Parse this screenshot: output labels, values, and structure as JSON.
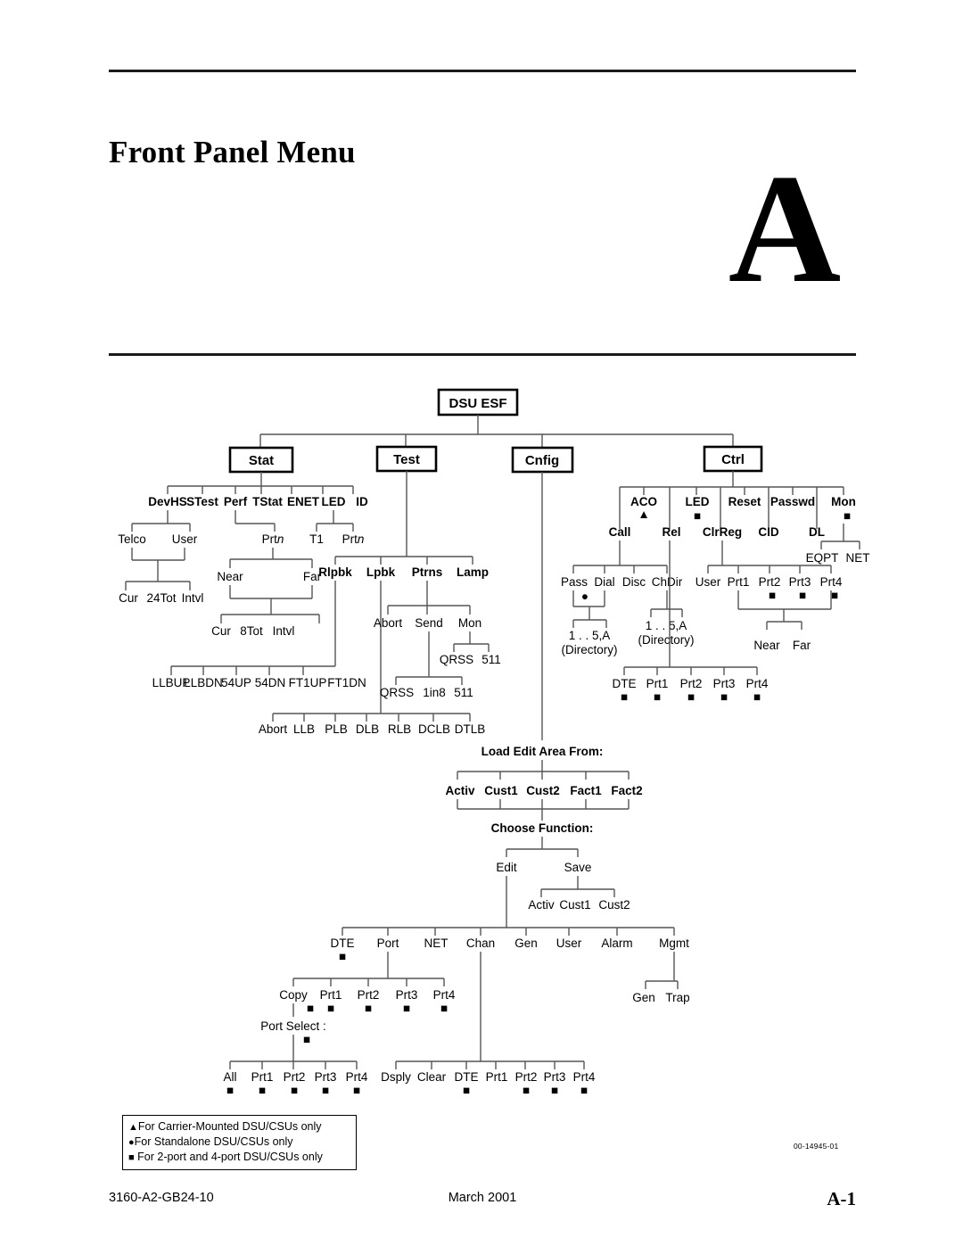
{
  "page": {
    "chapter_title": "Front Panel Menu",
    "chapter_letter": "A",
    "drawing_number": "00-14945-01"
  },
  "footer": {
    "left": "3160-A2-GB24-10",
    "center": "March 2001",
    "right": "A-1"
  },
  "legend": {
    "items": [
      {
        "glyph": "▲",
        "text": "For Carrier-Mounted DSU/CSUs only"
      },
      {
        "glyph": "●",
        "text": "For Standalone DSU/CSUs only"
      },
      {
        "glyph": "■",
        "text": "For 2-port and 4-port DSU/CSUs only"
      }
    ]
  },
  "diagram": {
    "root": "DSU ESF",
    "boxes": [
      "DSU ESF",
      "Stat",
      "Test",
      "Cnfig",
      "Ctrl"
    ],
    "stat": {
      "label": "Stat",
      "children": [
        "DevHS",
        "STest",
        "Perf",
        "TStat",
        "ENET",
        "LED",
        "ID"
      ],
      "devhs_children": [
        "Telco",
        "User"
      ],
      "telco_user_children": [
        "Cur",
        "24Tot",
        "Intvl"
      ],
      "perf_child": "Prtn",
      "prtn_children": [
        "Near",
        "Far"
      ],
      "near_far_children": [
        "Cur",
        "8Tot",
        "Intvl"
      ],
      "led_children": [
        "T1",
        "Prtn"
      ]
    },
    "test": {
      "label": "Test",
      "children": [
        "Rlpbk",
        "Lpbk",
        "Ptrns",
        "Lamp"
      ],
      "rlpbk_children": [
        "LLBUP",
        "LLBDN",
        "54UP",
        "54DN",
        "FT1UP",
        "FT1DN"
      ],
      "lpbk_children": [
        "Abort",
        "LLB",
        "PLB",
        "DLB",
        "RLB",
        "DCLB",
        "DTLB"
      ],
      "ptrns_children": [
        "Abort",
        "Send",
        "Mon"
      ],
      "send_children": [
        "QRSS",
        "1in8",
        "511"
      ],
      "mon_children": [
        "QRSS",
        "511"
      ]
    },
    "cnfig": {
      "label": "Cnfig",
      "load_prompt": "Load Edit Area From:",
      "load_options": [
        "Activ",
        "Cust1",
        "Cust2",
        "Fact1",
        "Fact2"
      ],
      "function_prompt": "Choose Function:",
      "functions": [
        "Edit",
        "Save"
      ],
      "save_options": [
        "Activ",
        "Cust1",
        "Cust2"
      ],
      "edit_children": [
        "DTE",
        "Port",
        "NET",
        "Chan",
        "Gen",
        "User",
        "Alarm",
        "Mgmt"
      ],
      "edit_children_marks": [
        "■",
        "",
        "",
        "",
        "",
        "",
        "",
        ""
      ],
      "port_children": [
        "Copy",
        "Prt1",
        "Prt2",
        "Prt3",
        "Prt4"
      ],
      "port_children_marks": [
        "■",
        "■",
        "■",
        "■",
        "■"
      ],
      "port_select_prompt": "Port Select :",
      "port_select_mark": "■",
      "port_select_children": [
        "All",
        "Prt1",
        "Prt2",
        "Prt3",
        "Prt4"
      ],
      "port_select_marks": [
        "■",
        "■",
        "■",
        "■",
        "■"
      ],
      "chan_children": [
        "Dsply",
        "Clear",
        "DTE",
        "Prt1",
        "Prt2",
        "Prt3",
        "Prt4"
      ],
      "chan_children_marks": [
        "",
        "",
        "■",
        "",
        "■",
        "■",
        "■"
      ],
      "mgmt_children": [
        "Gen",
        "Trap"
      ]
    },
    "ctrl": {
      "label": "Ctrl",
      "children": [
        "ACO",
        "LED",
        "Reset",
        "Passwd",
        "Mon"
      ],
      "children_marks": [
        "▲",
        "■",
        "",
        "",
        "■"
      ],
      "second_row": [
        "Call",
        "Rel",
        "ClrReg",
        "CID",
        "DL"
      ],
      "call_children": [
        "Pass",
        "Dial",
        "Disc",
        "ChDir"
      ],
      "pass_mark": "●",
      "directory_range": "1 . . 5,A",
      "directory_label": "(Directory)",
      "clrreg_children": [
        "User",
        "Prt1",
        "Prt2",
        "Prt3",
        "Prt4"
      ],
      "clrreg_marks": [
        "",
        "",
        "■",
        "■",
        "■"
      ],
      "near_far": [
        "Near",
        "Far"
      ],
      "led_children": [
        "DTE",
        "Prt1",
        "Prt2",
        "Prt3",
        "Prt4"
      ],
      "led_marks": [
        "■",
        "■",
        "■",
        "■",
        "■"
      ],
      "mon_children": [
        "EQPT",
        "NET"
      ]
    }
  }
}
